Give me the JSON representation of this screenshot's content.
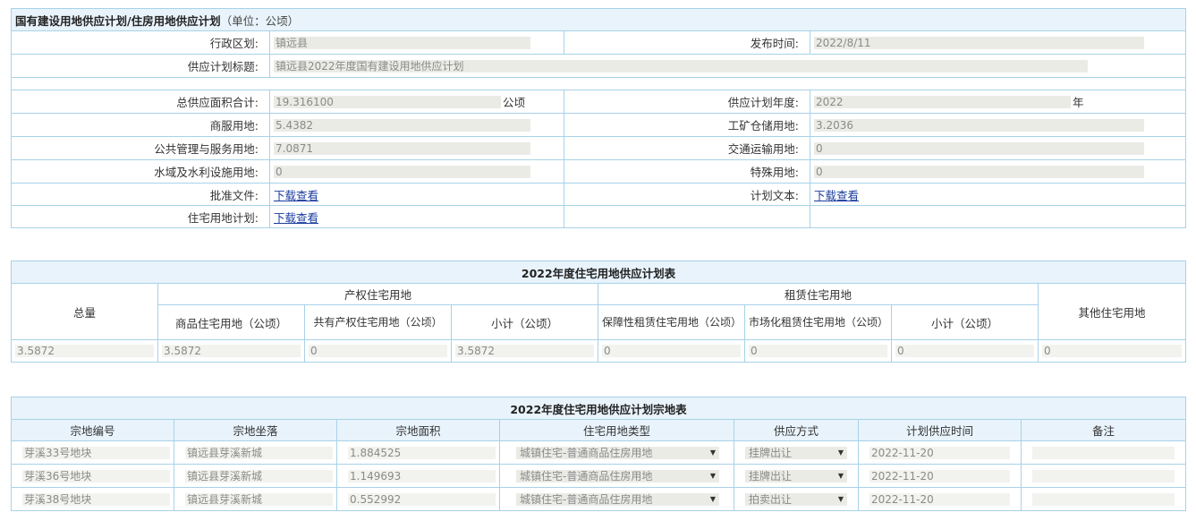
{
  "basic": {
    "title": "国有建设用地供应计划/住房用地供应计划",
    "unit": "（单位：公顷）",
    "region_label": "行政区划:",
    "region_value": "镇远县",
    "publish_label": "发布时间:",
    "publish_value": "2022/8/11",
    "plan_title_label": "供应计划标题:",
    "plan_title_value": "镇远县2022年度国有建设用地供应计划",
    "total_area_label": "总供应面积合计:",
    "total_area_value": "19.316100",
    "total_area_unit": "公顷",
    "plan_year_label": "供应计划年度:",
    "plan_year_value": "2022",
    "plan_year_unit": "年",
    "commercial_label": "商服用地:",
    "commercial_value": "5.4382",
    "industrial_label": "工矿仓储用地:",
    "industrial_value": "3.2036",
    "public_label": "公共管理与服务用地:",
    "public_value": "7.0871",
    "transport_label": "交通运输用地:",
    "transport_value": "0",
    "water_label": "水域及水利设施用地:",
    "water_value": "0",
    "special_label": "特殊用地:",
    "special_value": "0",
    "approval_label": "批准文件:",
    "approval_link": "下载查看",
    "plan_text_label": "计划文本:",
    "plan_text_link": "下载查看",
    "housing_plan_label": "住宅用地计划:",
    "housing_plan_link": "下载查看"
  },
  "housing_plan": {
    "title": "2022年度住宅用地供应计划表",
    "total_header": "总量",
    "property_header": "产权住宅用地",
    "rental_header": "租赁住宅用地",
    "other_header": "其他住宅用地",
    "sub_headers": [
      "商品住宅用地（公顷）",
      "共有产权住宅用地（公顷）",
      "小计（公顷）",
      "保障性租赁住宅用地（公顷）",
      "市场化租赁住宅用地（公顷）",
      "小计（公顷）"
    ],
    "values": [
      "3.5872",
      "3.5872",
      "0",
      "3.5872",
      "0",
      "0",
      "0",
      "0"
    ]
  },
  "parcels": {
    "title": "2022年度住宅用地供应计划宗地表",
    "headers": [
      "宗地编号",
      "宗地坐落",
      "宗地面积",
      "住宅用地类型",
      "供应方式",
      "计划供应时间",
      "备注"
    ],
    "rows": [
      {
        "id": "芽溪33号地块",
        "location": "镇远县芽溪新城",
        "area": "1.884525",
        "type": "城镇住宅-普通商品住房用地",
        "method": "挂牌出让",
        "time": "2022-11-20",
        "note": ""
      },
      {
        "id": "芽溪36号地块",
        "location": "镇远县芽溪新城",
        "area": "1.149693",
        "type": "城镇住宅-普通商品住房用地",
        "method": "挂牌出让",
        "time": "2022-11-20",
        "note": ""
      },
      {
        "id": "芽溪38号地块",
        "location": "镇远县芽溪新城",
        "area": "0.552992",
        "type": "城镇住宅-普通商品住房用地",
        "method": "拍卖出让",
        "time": "2022-11-20",
        "note": ""
      }
    ]
  }
}
